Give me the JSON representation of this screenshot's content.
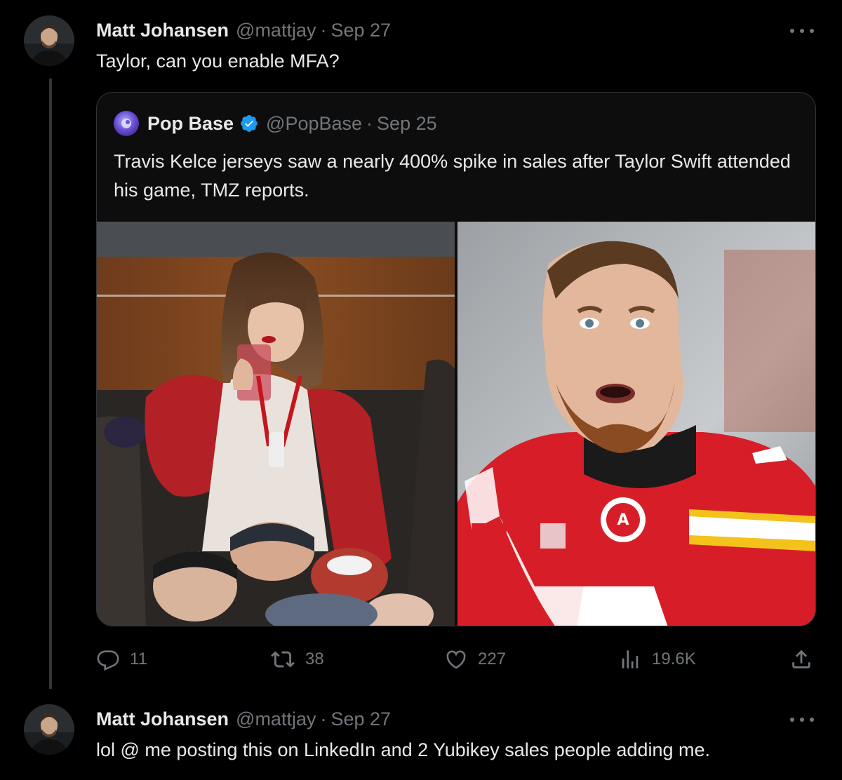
{
  "tweets": [
    {
      "author_name": "Matt Johansen",
      "handle": "@mattjay",
      "separator": "·",
      "date": "Sep 27",
      "text": "Taylor, can you enable MFA?",
      "quote": {
        "author_name": "Pop Base",
        "handle": "@PopBase",
        "separator": "·",
        "date": "Sep 25",
        "verified": true,
        "text": "Travis Kelce jerseys saw a nearly 400% spike in sales after Taylor Swift attended his game, TMZ reports.",
        "images": [
          "Taylor Swift in stadium suite wearing red jacket, drinking from a cup",
          "Travis Kelce in red Chiefs jersey"
        ]
      },
      "stats": {
        "replies": "11",
        "retweets": "38",
        "likes": "227",
        "views": "19.6K"
      }
    },
    {
      "author_name": "Matt Johansen",
      "handle": "@mattjay",
      "separator": "·",
      "date": "Sep 27",
      "text": "lol @ me posting this on LinkedIn and 2 Yubikey sales people adding me."
    }
  ],
  "icons": {
    "reply": "reply-icon",
    "retweet": "retweet-icon",
    "like": "heart-icon",
    "views": "views-icon",
    "share": "share-icon",
    "more": "more-icon",
    "verified": "verified-badge-icon"
  },
  "colors": {
    "background": "#000000",
    "text_primary": "#e7e9ea",
    "text_secondary": "#71767b",
    "border": "#333639",
    "verified_blue": "#1d9bf0"
  }
}
